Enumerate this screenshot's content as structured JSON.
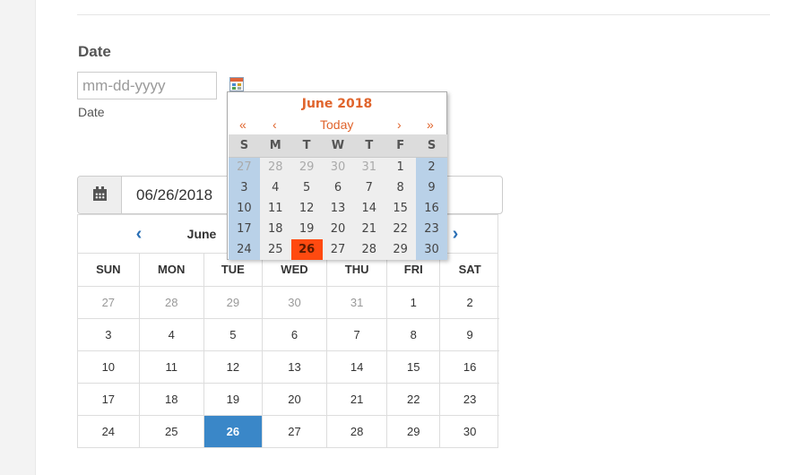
{
  "form": {
    "label": "Date",
    "placeholder": "mm-dd-yyyy",
    "sublabel": "Date"
  },
  "bootstrap_picker": {
    "value": "06/26/2018",
    "icon": "calendar-icon",
    "month_label": "June",
    "weekdays": [
      "SUN",
      "MON",
      "TUE",
      "WED",
      "THU",
      "FRI",
      "SAT"
    ],
    "weeks": [
      [
        "27",
        "28",
        "29",
        "30",
        "31",
        "1",
        "2"
      ],
      [
        "3",
        "4",
        "5",
        "6",
        "7",
        "8",
        "9"
      ],
      [
        "10",
        "11",
        "12",
        "13",
        "14",
        "15",
        "16"
      ],
      [
        "17",
        "18",
        "19",
        "20",
        "21",
        "22",
        "23"
      ],
      [
        "24",
        "25",
        "26",
        "27",
        "28",
        "29",
        "30"
      ]
    ],
    "selected_day": "26",
    "selected_color": "#3a87c8"
  },
  "popup": {
    "title": "June 2018",
    "nav": {
      "prev_year": "«",
      "prev_month": "‹",
      "today": "Today",
      "next_month": "›",
      "next_year": "»"
    },
    "weekdays": [
      "S",
      "M",
      "T",
      "W",
      "T",
      "F",
      "S"
    ],
    "weeks": [
      [
        "27",
        "28",
        "29",
        "30",
        "31",
        "1",
        "2"
      ],
      [
        "3",
        "4",
        "5",
        "6",
        "7",
        "8",
        "9"
      ],
      [
        "10",
        "11",
        "12",
        "13",
        "14",
        "15",
        "16"
      ],
      [
        "17",
        "18",
        "19",
        "20",
        "21",
        "22",
        "23"
      ],
      [
        "24",
        "25",
        "26",
        "27",
        "28",
        "29",
        "30"
      ]
    ],
    "today_day": "26",
    "accent_color": "#e0642c",
    "weekend_color": "#b9d1e8",
    "today_color": "#ff4a10"
  }
}
